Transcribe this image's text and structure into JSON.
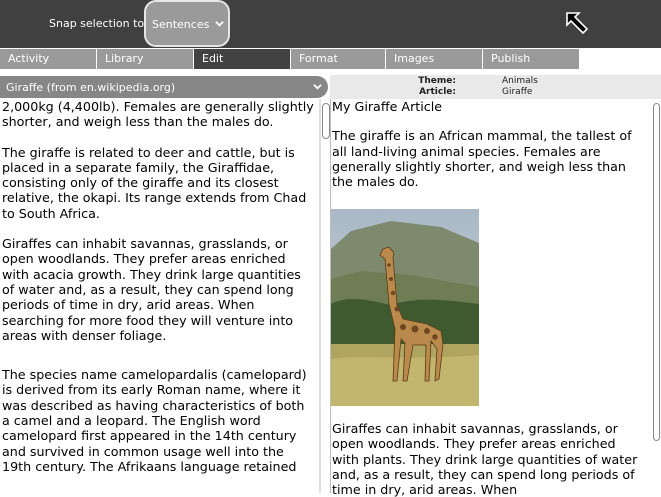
{
  "toolbar": {
    "snap_label": "Snap selection to:",
    "snap_value": "Sentences"
  },
  "tabs": [
    {
      "label": "Activity",
      "active": false
    },
    {
      "label": "Library",
      "active": false
    },
    {
      "label": "Edit",
      "active": true
    },
    {
      "label": "Format",
      "active": false
    },
    {
      "label": "Images",
      "active": false
    },
    {
      "label": "Publish",
      "active": false
    }
  ],
  "source": {
    "title": "Giraffe (from en.wikipedia.org)"
  },
  "meta": {
    "theme_key": "Theme:",
    "theme_value": "Animals",
    "article_key": "Article:",
    "article_value": "Giraffe"
  },
  "left_paragraphs": [
    "2,000kg (4,400lb). Females are generally slightly shorter, and weigh less than the males do.",
    "The giraffe is related to deer and cattle, but is placed in a separate family, the Giraffidae, consisting only of the giraffe and its closest relative, the okapi. Its range extends from Chad to South Africa.",
    "Giraffes can inhabit savannas, grasslands, or open woodlands. They prefer areas enriched with acacia growth. They drink large quantities of water and, as a result, they can spend long periods of time in dry, arid areas. When searching for more food they will venture into areas with denser foliage.",
    "The species name camelopardalis (camelopard) is derived from its early Roman name, where it was described as having characteristics of both a camel and a leopard. The English word camelopard first appeared in the 14th century and survived in common usage well into the 19th century. The Afrikaans language retained"
  ],
  "article": {
    "heading": "My Giraffe Article",
    "intro": "The giraffe is an African mammal, the tallest of all land-living animal species. Females are generally slightly shorter, and weigh less than the males do.",
    "after_image": "Giraffes can inhabit savannas, grasslands, or open woodlands. They prefer areas enriched with plants. They drink large quantities of water and, as a result, they can spend long periods of time in dry, arid areas. When"
  },
  "colors": {
    "toolbar_bg": "#404040",
    "tab_bg": "#9a9a9a",
    "tab_active_bg": "#424242",
    "header_bg": "#868686"
  }
}
